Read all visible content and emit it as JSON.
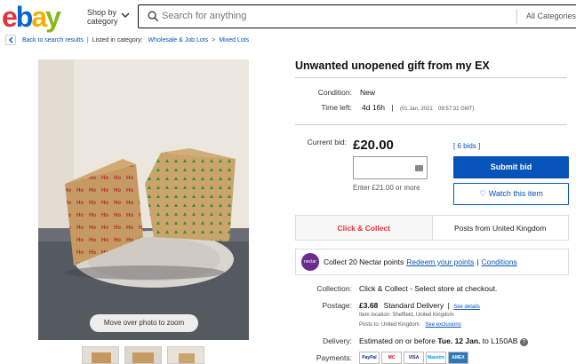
{
  "header": {
    "logo_letters": [
      "e",
      "b",
      "a",
      "y"
    ],
    "shop_by_line1": "Shop by",
    "shop_by_line2": "category",
    "search_placeholder": "Search for anything",
    "search_category": "All Categories"
  },
  "breadcrumb": {
    "back_label": "Back to search results",
    "listed_label": "Listed in category:",
    "cat1": "Wholesale & Job Lots",
    "separator": ">",
    "cat2": "Mixed Lots"
  },
  "gallery": {
    "zoom_hint": "Move over photo to zoom"
  },
  "listing": {
    "title": "Unwanted unopened gift from my EX",
    "condition_label": "Condition:",
    "condition_value": "New",
    "time_left_label": "Time left:",
    "time_left_value": "4d 16h",
    "time_left_sep": "|",
    "time_left_date": "(01 Jan, 2021",
    "time_left_time": "09:57:31 GMT)",
    "current_bid_label": "Current bid:",
    "price": "£20.00",
    "bids": "[ 6 bids ]",
    "enter_note": "Enter £21.00 or more",
    "submit_bid": "Submit bid",
    "watch_item": "Watch this item",
    "click_collect": "Click & Collect",
    "posts_from": "Posts from United Kingdom",
    "nectar_text": "Collect 20 Nectar points",
    "nectar_redeem": "Redeem your points",
    "nectar_sep": "|",
    "nectar_conditions": "Conditions",
    "nectar_logo": "nectar",
    "collection_label": "Collection:",
    "collection_value": "Click & Collect - Select store at checkout.",
    "postage_label": "Postage:",
    "postage_price": "£3.68",
    "postage_service": "Standard Delivery",
    "postage_sep": "|",
    "postage_details": "See details",
    "item_location": "Item location:  Sheffield, United Kingdom",
    "posts_to": "Posts to:   United Kingdom",
    "see_exclusions": "See exclusions",
    "delivery_label": "Delivery:",
    "delivery_text": "Estimated on or before",
    "delivery_date": "Tue. 12 Jan.",
    "delivery_to": "to L150AB",
    "payments_label": "Payments:",
    "payment_methods": [
      "PayPal",
      "MC",
      "VISA",
      "Maestro",
      "AMEX"
    ]
  },
  "colors": {
    "brand_blue": "#0654ba",
    "red": "#e53238"
  }
}
